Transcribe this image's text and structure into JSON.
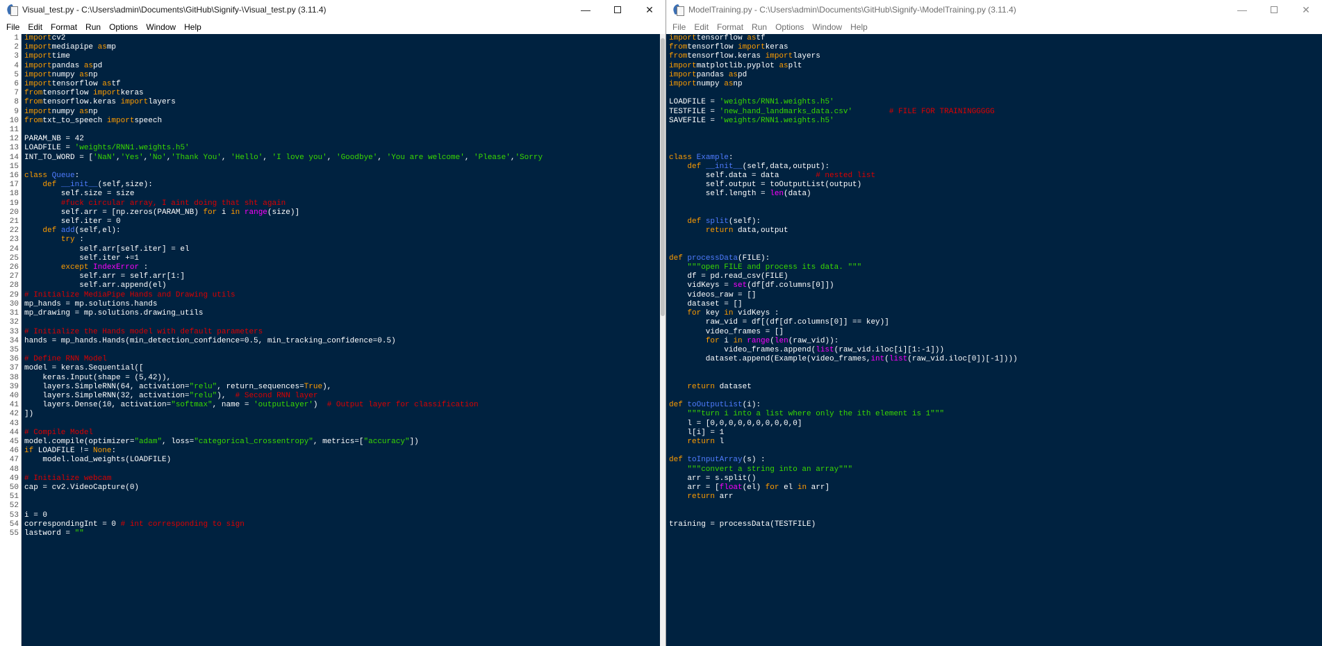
{
  "left_window": {
    "title": "Visual_test.py - C:\\Users\\admin\\Documents\\GitHub\\Signify-\\Visual_test.py (3.11.4)",
    "menu": [
      "File",
      "Edit",
      "Format",
      "Run",
      "Options",
      "Window",
      "Help"
    ],
    "controls": {
      "minimize": "—",
      "close": "✕"
    },
    "line_numbers": [
      "1",
      "2",
      "3",
      "4",
      "5",
      "6",
      "7",
      "8",
      "9",
      "10",
      "11",
      "12",
      "13",
      "14",
      "15",
      "16",
      "17",
      "18",
      "19",
      "20",
      "21",
      "22",
      "23",
      "24",
      "25",
      "26",
      "27",
      "28",
      "29",
      "30",
      "31",
      "32",
      "33",
      "34",
      "35",
      "36",
      "37",
      "38",
      "39",
      "40",
      "41",
      "42",
      "43",
      "44",
      "45",
      "46",
      "47",
      "48",
      "49",
      "50",
      "51",
      "52",
      "53",
      "54",
      "55"
    ],
    "code_lines": [
      [
        [
          "kw",
          "import"
        ],
        [
          "",
          "cv2"
        ]
      ],
      [
        [
          "kw",
          "import"
        ],
        [
          "",
          "mediapipe "
        ],
        [
          "kw",
          "as"
        ],
        [
          "",
          "mp"
        ]
      ],
      [
        [
          "kw",
          "import"
        ],
        [
          "",
          "time"
        ]
      ],
      [
        [
          "kw",
          "import"
        ],
        [
          "",
          "pandas "
        ],
        [
          "kw",
          "as"
        ],
        [
          "",
          "pd"
        ]
      ],
      [
        [
          "kw",
          "import"
        ],
        [
          "",
          "numpy "
        ],
        [
          "kw",
          "as"
        ],
        [
          "",
          "np"
        ]
      ],
      [
        [
          "kw",
          "import"
        ],
        [
          "",
          "tensorflow "
        ],
        [
          "kw",
          "as"
        ],
        [
          "",
          "tf"
        ]
      ],
      [
        [
          "kw",
          "from"
        ],
        [
          "",
          "tensorflow "
        ],
        [
          "kw",
          "import"
        ],
        [
          "",
          "keras"
        ]
      ],
      [
        [
          "kw",
          "from"
        ],
        [
          "",
          "tensorflow.keras "
        ],
        [
          "kw",
          "import"
        ],
        [
          "",
          "layers"
        ]
      ],
      [
        [
          "kw",
          "import"
        ],
        [
          "",
          "numpy "
        ],
        [
          "kw",
          "as"
        ],
        [
          "",
          "np"
        ]
      ],
      [
        [
          "kw",
          "from"
        ],
        [
          "",
          "txt_to_speech "
        ],
        [
          "kw",
          "import"
        ],
        [
          "",
          "speech"
        ]
      ],
      [],
      [
        [
          "",
          "PARAM_NB = 42"
        ]
      ],
      [
        [
          "",
          "LOADFILE = "
        ],
        [
          "st",
          "'weights/RNN1.weights.h5'"
        ]
      ],
      [
        [
          "",
          "INT_TO_WORD = ["
        ],
        [
          "st",
          "'NaN'"
        ],
        [
          "",
          ","
        ],
        [
          "st",
          "'Yes'"
        ],
        [
          "",
          ","
        ],
        [
          "st",
          "'No'"
        ],
        [
          "",
          ","
        ],
        [
          "st",
          "'Thank You'"
        ],
        [
          "",
          ", "
        ],
        [
          "st",
          "'Hello'"
        ],
        [
          "",
          ", "
        ],
        [
          "st",
          "'I love you'"
        ],
        [
          "",
          ", "
        ],
        [
          "st",
          "'Goodbye'"
        ],
        [
          "",
          ", "
        ],
        [
          "st",
          "'You are welcome'"
        ],
        [
          "",
          ", "
        ],
        [
          "st",
          "'Please'"
        ],
        [
          "",
          ","
        ],
        [
          "st",
          "'Sorry"
        ]
      ],
      [],
      [
        [
          "kw",
          "class"
        ],
        [
          "",
          " "
        ],
        [
          "df",
          "Queue"
        ],
        [
          "",
          ":"
        ]
      ],
      [
        [
          "",
          "    "
        ],
        [
          "kw",
          "def"
        ],
        [
          "",
          " "
        ],
        [
          "df",
          "__init__"
        ],
        [
          "",
          "(self,size):"
        ]
      ],
      [
        [
          "",
          "        self.size = size"
        ]
      ],
      [
        [
          "",
          "        "
        ],
        [
          "cm",
          "#fuck circular array, I aint doing that sht again"
        ]
      ],
      [
        [
          "",
          "        self.arr = [np.zeros(PARAM_NB) "
        ],
        [
          "kw",
          "for"
        ],
        [
          "",
          " i "
        ],
        [
          "kw",
          "in"
        ],
        [
          "",
          " "
        ],
        [
          "bi",
          "range"
        ],
        [
          "",
          "(size)]"
        ]
      ],
      [
        [
          "",
          "        self.iter = 0"
        ]
      ],
      [
        [
          "",
          "    "
        ],
        [
          "kw",
          "def"
        ],
        [
          "",
          " "
        ],
        [
          "df",
          "add"
        ],
        [
          "",
          "(self,el):"
        ]
      ],
      [
        [
          "",
          "        "
        ],
        [
          "kw",
          "try"
        ],
        [
          "",
          " :"
        ]
      ],
      [
        [
          "",
          "            self.arr[self.iter] = el"
        ]
      ],
      [
        [
          "",
          "            self.iter +=1"
        ]
      ],
      [
        [
          "",
          "        "
        ],
        [
          "kw",
          "except"
        ],
        [
          "",
          " "
        ],
        [
          "bi",
          "IndexError"
        ],
        [
          "",
          " :"
        ]
      ],
      [
        [
          "",
          "            self.arr = self.arr[1:]"
        ]
      ],
      [
        [
          "",
          "            self.arr.append(el)"
        ]
      ],
      [
        [
          "cm",
          "# Initialize MediaPipe Hands and Drawing utils"
        ]
      ],
      [
        [
          "",
          "mp_hands = mp.solutions.hands"
        ]
      ],
      [
        [
          "",
          "mp_drawing = mp.solutions.drawing_utils"
        ]
      ],
      [],
      [
        [
          "cm",
          "# Initialize the Hands model with default parameters"
        ]
      ],
      [
        [
          "",
          "hands = mp_hands.Hands(min_detection_confidence=0.5, min_tracking_confidence=0.5)"
        ]
      ],
      [],
      [
        [
          "cm",
          "# Define RNN Model"
        ]
      ],
      [
        [
          "",
          "model = keras.Sequential(["
        ]
      ],
      [
        [
          "",
          "    keras.Input(shape = (5,42)),"
        ]
      ],
      [
        [
          "",
          "    layers.SimpleRNN(64, activation="
        ],
        [
          "st",
          "\"relu\""
        ],
        [
          "",
          ", return_sequences="
        ],
        [
          "kw",
          "True"
        ],
        [
          "",
          "),"
        ]
      ],
      [
        [
          "",
          "    layers.SimpleRNN(32, activation="
        ],
        [
          "st",
          "\"relu\""
        ],
        [
          "",
          "),  "
        ],
        [
          "cm",
          "# Second RNN layer"
        ]
      ],
      [
        [
          "",
          "    layers.Dense(10, activation="
        ],
        [
          "st",
          "\"softmax\""
        ],
        [
          "",
          ", name = "
        ],
        [
          "st",
          "'outputLayer'"
        ],
        [
          "",
          ")  "
        ],
        [
          "cm",
          "# Output layer for classification"
        ]
      ],
      [
        [
          "",
          "])"
        ]
      ],
      [],
      [
        [
          "cm",
          "# Compile Model"
        ]
      ],
      [
        [
          "",
          "model.compile(optimizer="
        ],
        [
          "st",
          "\"adam\""
        ],
        [
          "",
          ", loss="
        ],
        [
          "st",
          "\"categorical_crossentropy\""
        ],
        [
          "",
          ", metrics=["
        ],
        [
          "st",
          "\"accuracy\""
        ],
        [
          "",
          "])"
        ]
      ],
      [
        [
          "kw",
          "if"
        ],
        [
          "",
          " LOADFILE != "
        ],
        [
          "kw",
          "None"
        ],
        [
          "",
          ":"
        ]
      ],
      [
        [
          "",
          "    model.load_weights(LOADFILE)"
        ]
      ],
      [],
      [
        [
          "cm",
          "# Initialize webcam"
        ]
      ],
      [
        [
          "",
          "cap = cv2.VideoCapture(0)"
        ]
      ],
      [],
      [],
      [
        [
          "",
          "i = 0"
        ]
      ],
      [
        [
          "",
          "correspondingInt = 0 "
        ],
        [
          "cm",
          "# int corresponding to sign"
        ]
      ],
      [
        [
          "",
          "lastword = "
        ],
        [
          "st",
          "\"\""
        ]
      ]
    ]
  },
  "right_window": {
    "title": "ModelTraining.py - C:\\Users\\admin\\Documents\\GitHub\\Signify-\\ModelTraining.py (3.11.4)",
    "menu": [
      "File",
      "Edit",
      "Format",
      "Run",
      "Options",
      "Window",
      "Help"
    ],
    "controls": {
      "minimize": "—",
      "close": "✕"
    },
    "code_lines": [
      [
        [
          "kw",
          "import"
        ],
        [
          "",
          "tensorflow "
        ],
        [
          "kw",
          "as"
        ],
        [
          "",
          "tf"
        ]
      ],
      [
        [
          "kw",
          "from"
        ],
        [
          "",
          "tensorflow "
        ],
        [
          "kw",
          "import"
        ],
        [
          "",
          "keras"
        ]
      ],
      [
        [
          "kw",
          "from"
        ],
        [
          "",
          "tensorflow.keras "
        ],
        [
          "kw",
          "import"
        ],
        [
          "",
          "layers"
        ]
      ],
      [
        [
          "kw",
          "import"
        ],
        [
          "",
          "matplotlib.pyplot "
        ],
        [
          "kw",
          "as"
        ],
        [
          "",
          "plt"
        ]
      ],
      [
        [
          "kw",
          "import"
        ],
        [
          "",
          "pandas "
        ],
        [
          "kw",
          "as"
        ],
        [
          "",
          "pd"
        ]
      ],
      [
        [
          "kw",
          "import"
        ],
        [
          "",
          "numpy "
        ],
        [
          "kw",
          "as"
        ],
        [
          "",
          "np"
        ]
      ],
      [],
      [
        [
          "",
          "LOADFILE = "
        ],
        [
          "st",
          "'weights/RNN1.weights.h5'"
        ]
      ],
      [
        [
          "",
          "TESTFILE = "
        ],
        [
          "st",
          "'new_hand_landmarks_data.csv'"
        ],
        [
          "",
          "        "
        ],
        [
          "cm",
          "# FILE FOR TRAININGGGGG"
        ]
      ],
      [
        [
          "",
          "SAVEFILE = "
        ],
        [
          "st",
          "'weights/RNN1.weights.h5'"
        ]
      ],
      [],
      [],
      [],
      [
        [
          "kw",
          "class"
        ],
        [
          "",
          " "
        ],
        [
          "df",
          "Example"
        ],
        [
          "",
          ":"
        ]
      ],
      [
        [
          "",
          "    "
        ],
        [
          "kw",
          "def"
        ],
        [
          "",
          " "
        ],
        [
          "df",
          "__init__"
        ],
        [
          "",
          "(self,data,output):"
        ]
      ],
      [
        [
          "",
          "        self.data = data        "
        ],
        [
          "cm",
          "# nested list"
        ]
      ],
      [
        [
          "",
          "        self.output = toOutputList(output)"
        ]
      ],
      [
        [
          "",
          "        self.length = "
        ],
        [
          "bi",
          "len"
        ],
        [
          "",
          "(data)"
        ]
      ],
      [],
      [],
      [
        [
          "",
          "    "
        ],
        [
          "kw",
          "def"
        ],
        [
          "",
          " "
        ],
        [
          "df",
          "split"
        ],
        [
          "",
          "(self):"
        ]
      ],
      [
        [
          "",
          "        "
        ],
        [
          "kw",
          "return"
        ],
        [
          "",
          " data,output"
        ]
      ],
      [],
      [],
      [
        [
          "kw",
          "def"
        ],
        [
          "",
          " "
        ],
        [
          "df",
          "processData"
        ],
        [
          "",
          "(FILE):"
        ]
      ],
      [
        [
          "",
          "    "
        ],
        [
          "st",
          "\"\"\"open FILE and process its data. \"\"\""
        ]
      ],
      [
        [
          "",
          "    df = pd.read_csv(FILE)"
        ]
      ],
      [
        [
          "",
          "    vidKeys = "
        ],
        [
          "bi",
          "set"
        ],
        [
          "",
          "(df[df.columns[0]])"
        ]
      ],
      [
        [
          "",
          "    videos_raw = []"
        ]
      ],
      [
        [
          "",
          "    dataset = []"
        ]
      ],
      [
        [
          "",
          "    "
        ],
        [
          "kw",
          "for"
        ],
        [
          "",
          " key "
        ],
        [
          "kw",
          "in"
        ],
        [
          "",
          " vidKeys :"
        ]
      ],
      [
        [
          "",
          "        raw_vid = df[(df[df.columns[0]] == key)]"
        ]
      ],
      [
        [
          "",
          "        video_frames = []"
        ]
      ],
      [
        [
          "",
          "        "
        ],
        [
          "kw",
          "for"
        ],
        [
          "",
          " i "
        ],
        [
          "kw",
          "in"
        ],
        [
          "",
          " "
        ],
        [
          "bi",
          "range"
        ],
        [
          "",
          "("
        ],
        [
          "bi",
          "len"
        ],
        [
          "",
          "(raw_vid)):"
        ]
      ],
      [
        [
          "",
          "            video_frames.append("
        ],
        [
          "bi",
          "list"
        ],
        [
          "",
          "(raw_vid.iloc[i][1:-1]))"
        ]
      ],
      [
        [
          "",
          "        dataset.append(Example(video_frames,"
        ],
        [
          "bi",
          "int"
        ],
        [
          "",
          "("
        ],
        [
          "bi",
          "list"
        ],
        [
          "",
          "(raw_vid.iloc[0])[-1])))"
        ]
      ],
      [],
      [],
      [
        [
          "",
          "    "
        ],
        [
          "kw",
          "return"
        ],
        [
          "",
          " dataset"
        ]
      ],
      [],
      [
        [
          "kw",
          "def"
        ],
        [
          "",
          " "
        ],
        [
          "df",
          "toOutputList"
        ],
        [
          "",
          "(i):"
        ]
      ],
      [
        [
          "",
          "    "
        ],
        [
          "st",
          "\"\"\"turn i into a list where only the ith element is 1\"\"\""
        ]
      ],
      [
        [
          "",
          "    l = [0,0,0,0,0,0,0,0,0,0]"
        ]
      ],
      [
        [
          "",
          "    l[i] = 1"
        ]
      ],
      [
        [
          "",
          "    "
        ],
        [
          "kw",
          "return"
        ],
        [
          "",
          " l"
        ]
      ],
      [],
      [
        [
          "kw",
          "def"
        ],
        [
          "",
          " "
        ],
        [
          "df",
          "toInputArray"
        ],
        [
          "",
          "(s) :"
        ]
      ],
      [
        [
          "",
          "    "
        ],
        [
          "st",
          "\"\"\"convert a string into an array\"\"\""
        ]
      ],
      [
        [
          "",
          "    arr = s.split()"
        ]
      ],
      [
        [
          "",
          "    arr = ["
        ],
        [
          "bi",
          "float"
        ],
        [
          "",
          "(el) "
        ],
        [
          "kw",
          "for"
        ],
        [
          "",
          " el "
        ],
        [
          "kw",
          "in"
        ],
        [
          "",
          " arr]"
        ]
      ],
      [
        [
          "",
          "    "
        ],
        [
          "kw",
          "return"
        ],
        [
          "",
          " arr"
        ]
      ],
      [],
      [],
      [
        [
          "",
          "training = processData(TESTFILE)"
        ]
      ]
    ]
  },
  "colors": {
    "editor_bg": "#002240",
    "keyword": "#ff9d00",
    "builtin": "#ff00ff",
    "string": "#3ad900",
    "comment": "#dd0000",
    "definition": "#4f7cff"
  },
  "icons": {
    "app": "idle-python-icon",
    "minimize": "minimize-icon",
    "maximize": "maximize-icon",
    "close": "close-icon"
  }
}
